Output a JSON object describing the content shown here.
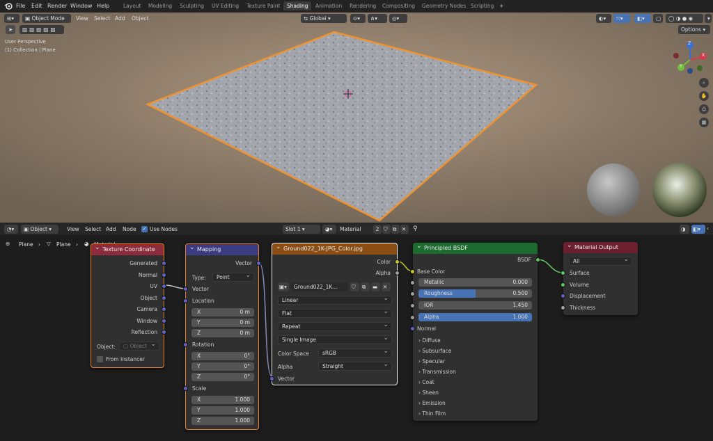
{
  "topbar": {
    "menus": [
      "File",
      "Edit",
      "Render",
      "Window",
      "Help"
    ],
    "workspaces": [
      "Layout",
      "Modeling",
      "Sculpting",
      "UV Editing",
      "Texture Paint",
      "Shading",
      "Animation",
      "Rendering",
      "Compositing",
      "Geometry Nodes",
      "Scripting",
      "+"
    ],
    "active_workspace": "Shading"
  },
  "viewport": {
    "mode": "Object Mode",
    "menus": [
      "View",
      "Select",
      "Add",
      "Object"
    ],
    "transform": "Global",
    "options": "Options",
    "info_line1": "User Perspective",
    "info_line2": "(1) Collection | Plane",
    "gizmo": {
      "x": "X",
      "y": "Y",
      "z": "Z"
    }
  },
  "node_editor": {
    "mode": "Object",
    "menus": [
      "View",
      "Select",
      "Add",
      "Node"
    ],
    "use_nodes": "Use Nodes",
    "slot": "Slot 1",
    "material": "Material",
    "users": "2",
    "breadcrumb": [
      "Plane",
      "Plane",
      "Material"
    ]
  },
  "nodes": {
    "texcoord": {
      "title": "Texture Coordinate",
      "outputs": [
        "Generated",
        "Normal",
        "UV",
        "Object",
        "Camera",
        "Window",
        "Reflection"
      ],
      "object_label": "Object:",
      "object_placeholder": "Object",
      "from_instancer": "From Instancer"
    },
    "mapping": {
      "title": "Mapping",
      "output": "Vector",
      "type_label": "Type:",
      "type_value": "Point",
      "vector": "Vector",
      "location": "Location",
      "loc": [
        [
          "X",
          "0 m"
        ],
        [
          "Y",
          "0 m"
        ],
        [
          "Z",
          "0 m"
        ]
      ],
      "rotation": "Rotation",
      "rot": [
        [
          "X",
          "0°"
        ],
        [
          "Y",
          "0°"
        ],
        [
          "Z",
          "0°"
        ]
      ],
      "scale": "Scale",
      "scl": [
        [
          "X",
          "1.000"
        ],
        [
          "Y",
          "1.000"
        ],
        [
          "Z",
          "1.000"
        ]
      ]
    },
    "image": {
      "title": "Ground022_1K-JPG_Color.jpg",
      "out_color": "Color",
      "out_alpha": "Alpha",
      "image_name": "Ground022_1K...",
      "interp": "Linear",
      "proj": "Flat",
      "ext": "Repeat",
      "source": "Single Image",
      "cs_label": "Color Space",
      "cs_value": "sRGB",
      "alpha_label": "Alpha",
      "alpha_value": "Straight",
      "vector": "Vector"
    },
    "bsdf": {
      "title": "Principled BSDF",
      "output": "BSDF",
      "base_color": "Base Color",
      "metallic": [
        "Metallic",
        "0.000"
      ],
      "roughness": [
        "Roughness",
        "0.500"
      ],
      "roughness_fill": 0.5,
      "ior": [
        "IOR",
        "1.450"
      ],
      "alpha": [
        "Alpha",
        "1.000"
      ],
      "alpha_fill": 1.0,
      "normal": "Normal",
      "panels": [
        "Diffuse",
        "Subsurface",
        "Specular",
        "Transmission",
        "Coat",
        "Sheen",
        "Emission",
        "Thin Film"
      ]
    },
    "output": {
      "title": "Material Output",
      "target": "All",
      "inputs": [
        "Surface",
        "Volume",
        "Displacement",
        "Thickness"
      ]
    }
  },
  "colors": {
    "texcoord_hdr": "#8c2c3c",
    "mapping_hdr": "#3c3c83",
    "image_hdr": "#8a4d14",
    "bsdf_hdr": "#1d6b2f",
    "output_hdr": "#6b1f2f",
    "selected": "#e8822a",
    "vector_socket": "#6363c7",
    "color_socket": "#c7c729",
    "float_socket": "#a1a1a1",
    "shader_socket": "#63c763",
    "field_blue": "#4772b3"
  }
}
